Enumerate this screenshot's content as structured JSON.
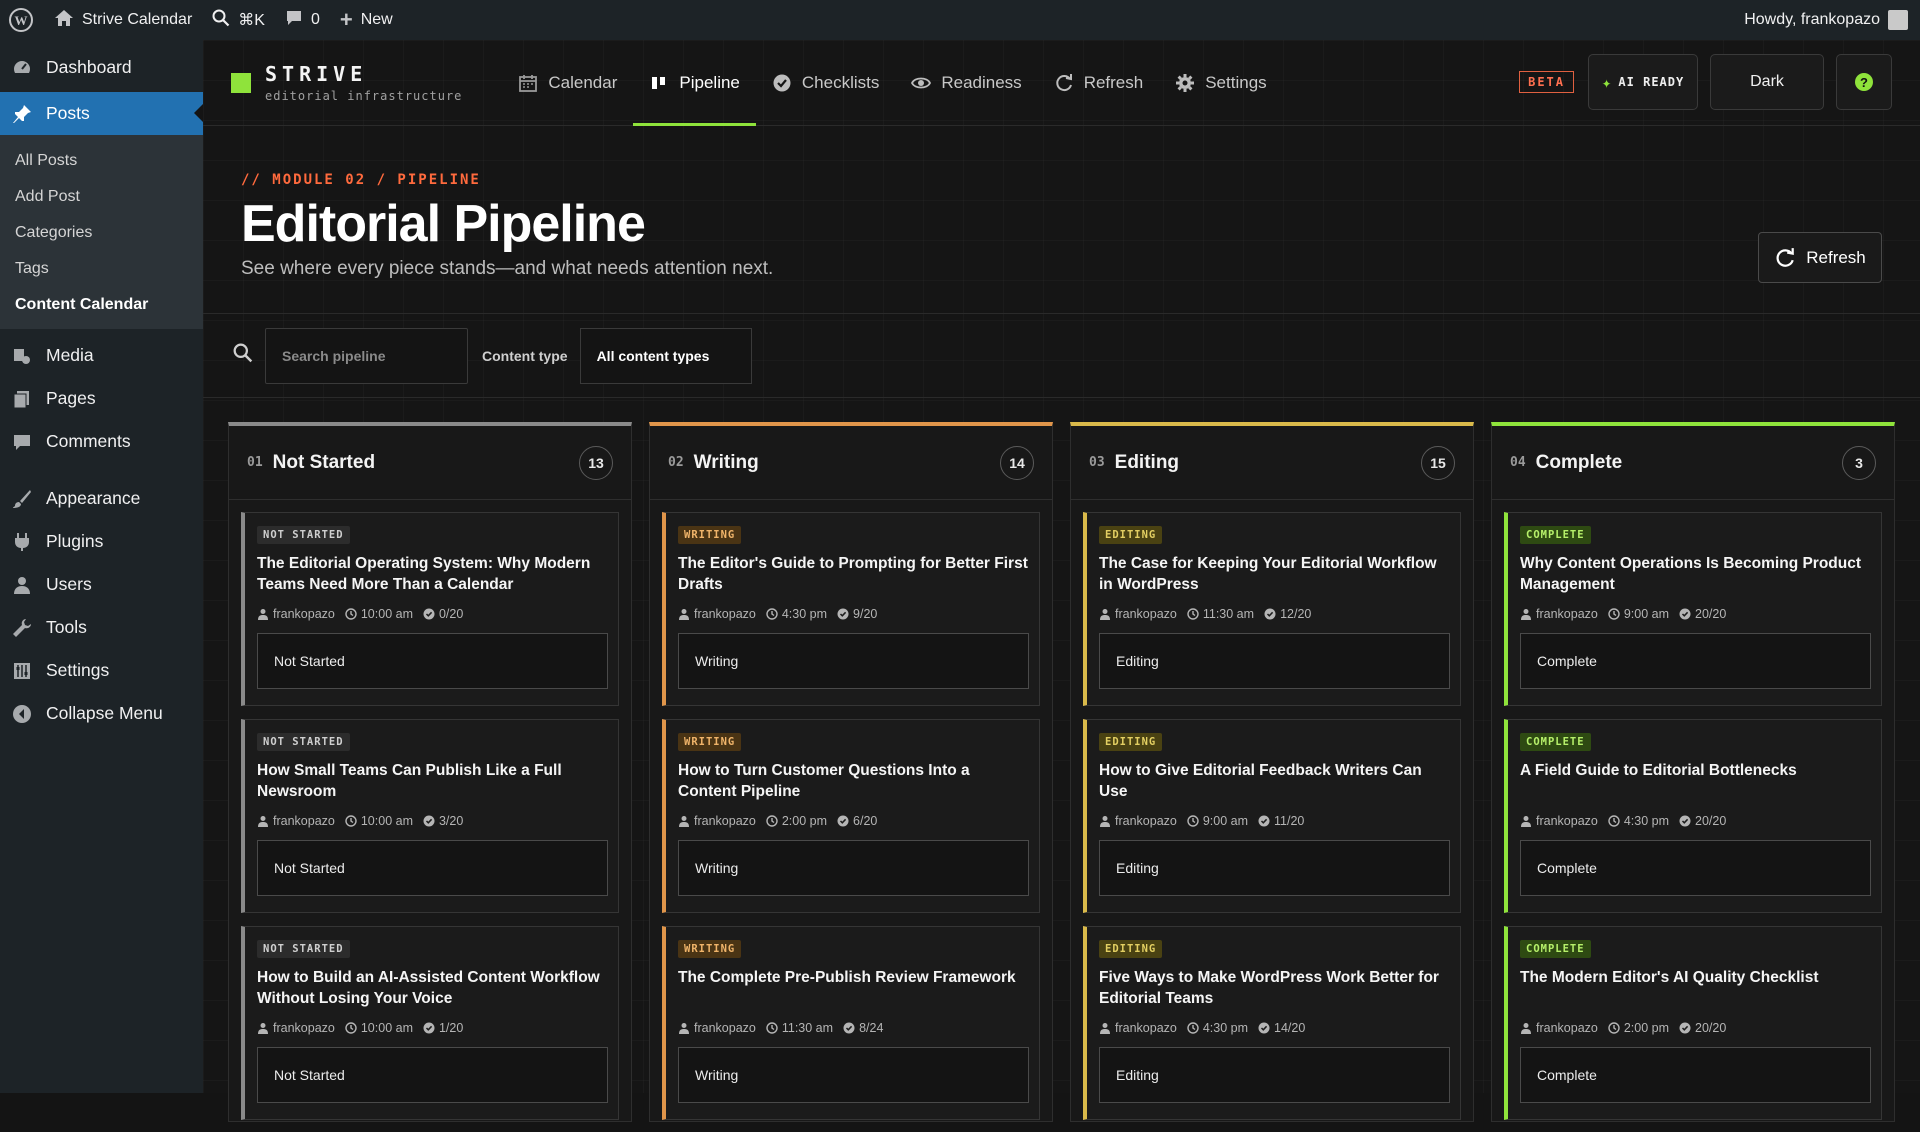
{
  "adminbar": {
    "site_name": "Strive Calendar",
    "search_shortcut": "⌘K",
    "comments_count": "0",
    "new_label": "New",
    "greeting": "Howdy, frankopazo"
  },
  "sidebar": {
    "items": [
      {
        "label": "Dashboard",
        "icon": "dashboard-icon"
      },
      {
        "label": "Posts",
        "icon": "pin-icon"
      },
      {
        "label": "Media",
        "icon": "media-icon"
      },
      {
        "label": "Pages",
        "icon": "pages-icon"
      },
      {
        "label": "Comments",
        "icon": "comments-icon"
      },
      {
        "label": "Appearance",
        "icon": "brush-icon"
      },
      {
        "label": "Plugins",
        "icon": "plugins-icon"
      },
      {
        "label": "Users",
        "icon": "users-icon"
      },
      {
        "label": "Tools",
        "icon": "wrench-icon"
      },
      {
        "label": "Settings",
        "icon": "settings-icon"
      },
      {
        "label": "Collapse Menu",
        "icon": "collapse-icon"
      }
    ],
    "posts_submenu": [
      "All Posts",
      "Add Post",
      "Categories",
      "Tags",
      "Content Calendar"
    ]
  },
  "topnav": {
    "brand_name": "STRIVE",
    "brand_tagline": "editorial infrastructure",
    "tabs": [
      "Calendar",
      "Pipeline",
      "Checklists",
      "Readiness",
      "Refresh",
      "Settings"
    ],
    "beta_label": "BETA",
    "ai_label": "AI READY",
    "theme_label": "Dark",
    "help_label": "?"
  },
  "header": {
    "eyebrow": "// MODULE 02 / PIPELINE",
    "title": "Editorial Pipeline",
    "subtitle": "See where every piece stands—and what needs attention next.",
    "refresh_label": "Refresh"
  },
  "filter": {
    "search_placeholder": "Search pipeline",
    "content_type_label": "Content type",
    "content_type_value": "All content types"
  },
  "colors": {
    "not_started": "#8a8a8a",
    "writing": "#e0954a",
    "editing": "#d9b94a",
    "complete": "#8fe33b",
    "accent": "#8fe33b",
    "eyebrow": "#ff6a3d"
  },
  "columns": [
    {
      "num": "01",
      "title": "Not Started",
      "count": "13",
      "cards": [
        {
          "badge": "NOT STARTED",
          "title": "The Editorial Operating System: Why Modern Teams Need More Than a Calendar",
          "author": "frankopazo",
          "time": "10:00 am",
          "checks": "0/20",
          "status": "Not Started"
        },
        {
          "badge": "NOT STARTED",
          "title": "How Small Teams Can Publish Like a Full Newsroom",
          "author": "frankopazo",
          "time": "10:00 am",
          "checks": "3/20",
          "status": "Not Started"
        },
        {
          "badge": "NOT STARTED",
          "title": "How to Build an AI-Assisted Content Workflow Without Losing Your Voice",
          "author": "frankopazo",
          "time": "10:00 am",
          "checks": "1/20",
          "status": "Not Started"
        }
      ]
    },
    {
      "num": "02",
      "title": "Writing",
      "count": "14",
      "cards": [
        {
          "badge": "WRITING",
          "title": "The Editor's Guide to Prompting for Better First Drafts",
          "author": "frankopazo",
          "time": "4:30 pm",
          "checks": "9/20",
          "status": "Writing"
        },
        {
          "badge": "WRITING",
          "title": "How to Turn Customer Questions Into a Content Pipeline",
          "author": "frankopazo",
          "time": "2:00 pm",
          "checks": "6/20",
          "status": "Writing"
        },
        {
          "badge": "WRITING",
          "title": "The Complete Pre-Publish Review Framework",
          "author": "frankopazo",
          "time": "11:30 am",
          "checks": "8/24",
          "status": "Writing"
        }
      ]
    },
    {
      "num": "03",
      "title": "Editing",
      "count": "15",
      "cards": [
        {
          "badge": "EDITING",
          "title": "The Case for Keeping Your Editorial Workflow in WordPress",
          "author": "frankopazo",
          "time": "11:30 am",
          "checks": "12/20",
          "status": "Editing"
        },
        {
          "badge": "EDITING",
          "title": "How to Give Editorial Feedback Writers Can Use",
          "author": "frankopazo",
          "time": "9:00 am",
          "checks": "11/20",
          "status": "Editing"
        },
        {
          "badge": "EDITING",
          "title": "Five Ways to Make WordPress Work Better for Editorial Teams",
          "author": "frankopazo",
          "time": "4:30 pm",
          "checks": "14/20",
          "status": "Editing"
        }
      ]
    },
    {
      "num": "04",
      "title": "Complete",
      "count": "3",
      "cards": [
        {
          "badge": "COMPLETE",
          "title": "Why Content Operations Is Becoming Product Management",
          "author": "frankopazo",
          "time": "9:00 am",
          "checks": "20/20",
          "status": "Complete"
        },
        {
          "badge": "COMPLETE",
          "title": "A Field Guide to Editorial Bottlenecks",
          "author": "frankopazo",
          "time": "4:30 pm",
          "checks": "20/20",
          "status": "Complete"
        },
        {
          "badge": "COMPLETE",
          "title": "The Modern Editor's AI Quality Checklist",
          "author": "frankopazo",
          "time": "2:00 pm",
          "checks": "20/20",
          "status": "Complete"
        }
      ]
    }
  ]
}
